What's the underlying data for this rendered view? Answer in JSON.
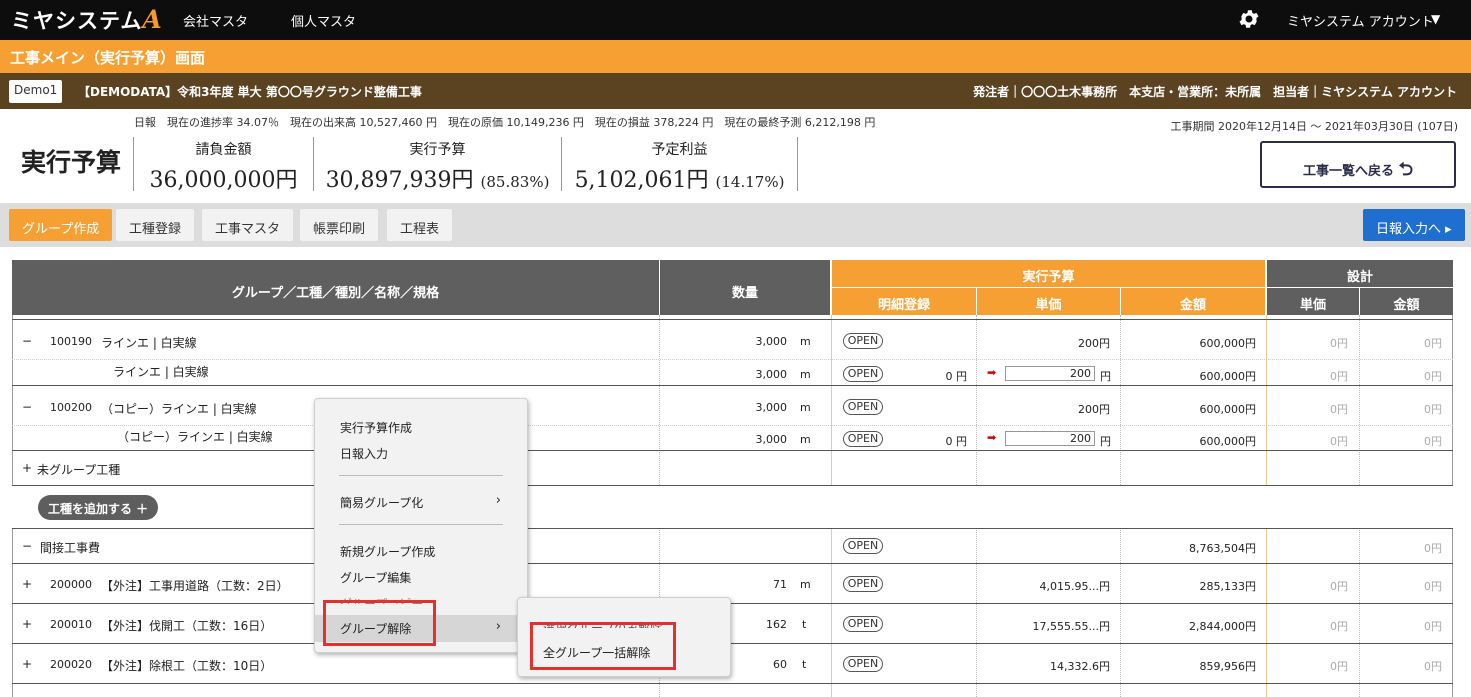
{
  "nav": {
    "logo": "ミヤシステム",
    "logo_accent": "A",
    "links": [
      "会社マスタ",
      "個人マスタ"
    ],
    "account": "ミヤシステム アカウント"
  },
  "screen_title": "工事メイン（実行予算）画面",
  "project": {
    "badge": "Demo1",
    "title": "【DEMODATA】令和3年度 単大 第〇〇号グラウンド整備工事",
    "right": "発注者｜〇〇〇土木事務所　本支店・営業所：未所属　担当者｜ミヤシステム アカウント"
  },
  "stats_line": "日報　現在の進捗率 34.07％　現在の出来高 10,527,460 円　現在の原価 10,149,236 円　現在の損益 378,224 円　現在の最終予測 6,212,198 円",
  "period": "工事期間 2020年12月14日 〜 2021年03月30日 (107日)",
  "summary": {
    "heading": "実行予算",
    "kpis": [
      {
        "label": "請負金額",
        "value": "36,000,000円",
        "pct": ""
      },
      {
        "label": "実行予算",
        "value": "30,897,939円",
        "pct": "(85.83%)"
      },
      {
        "label": "予定利益",
        "value": "5,102,061円",
        "pct": "(14.17%)"
      }
    ],
    "back_button": "工事一覧へ戻る"
  },
  "toolbar": {
    "buttons": [
      "グループ作成",
      "工種登録",
      "工事マスタ",
      "帳票印刷",
      "工程表"
    ],
    "right_button": "日報入力へ"
  },
  "grid": {
    "headers": {
      "name": "グループ／工種／種別／名称／規格",
      "qty": "数量",
      "exec": "実行予算",
      "design": "設計",
      "exec_sub": [
        "明細登録",
        "単価",
        "金額"
      ],
      "design_sub": [
        "単価",
        "金額"
      ]
    },
    "rows": [
      {
        "toggle": "−",
        "code": "100190",
        "name": "ラインエ | 白実線",
        "qty": "3,000",
        "unit": "m",
        "open": "OPEN",
        "detail": "",
        "price": "200円",
        "input": "",
        "amount": "600,000円",
        "d_price": "0円",
        "d_amount": "0円"
      },
      {
        "toggle": "",
        "code": "",
        "name": "ラインエ | 白実線",
        "qty": "3,000",
        "unit": "m",
        "open": "OPEN",
        "detail": "0 円",
        "price": "",
        "input": "200",
        "amount": "600,000円",
        "d_price": "0円",
        "d_amount": "0円"
      },
      {
        "toggle": "−",
        "code": "100200",
        "name": "（コピー）ラインエ | 白実線",
        "qty": "3,000",
        "unit": "m",
        "open": "OPEN",
        "detail": "",
        "price": "200円",
        "input": "",
        "amount": "600,000円",
        "d_price": "0円",
        "d_amount": "0円"
      },
      {
        "toggle": "",
        "code": "",
        "name": "（コピー）ラインエ | 白実線",
        "qty": "3,000",
        "unit": "m",
        "open": "OPEN",
        "detail": "0 円",
        "price": "",
        "input": "200",
        "amount": "600,000円",
        "d_price": "0円",
        "d_amount": "0円"
      },
      {
        "toggle": "+",
        "code": "",
        "name": "未グループ工種",
        "qty": "",
        "unit": "",
        "open": "",
        "detail": "",
        "price": "",
        "input": "",
        "amount": "",
        "d_price": "",
        "d_amount": ""
      },
      {
        "toggle": "−",
        "code": "",
        "name": "間接工事費",
        "qty": "",
        "unit": "",
        "open": "OPEN",
        "detail": "",
        "price": "",
        "input": "",
        "amount": "8,763,504円",
        "d_price": "",
        "d_amount": "0円"
      },
      {
        "toggle": "+",
        "code": "200000",
        "name": "【外注】工事用道路（工数：2日）",
        "qty": "71",
        "unit": "m",
        "open": "OPEN",
        "detail": "",
        "price": "4,015.95...円",
        "input": "",
        "amount": "285,133円",
        "d_price": "0円",
        "d_amount": "0円"
      },
      {
        "toggle": "+",
        "code": "200010",
        "name": "【外注】伐開工（工数：16日）",
        "qty": "162",
        "unit": "t",
        "open": "OPEN",
        "detail": "",
        "price": "17,555.55...円",
        "input": "",
        "amount": "2,844,000円",
        "d_price": "0円",
        "d_amount": "0円"
      },
      {
        "toggle": "+",
        "code": "200020",
        "name": "【外注】除根工（工数：10日）",
        "qty": "60",
        "unit": "t",
        "open": "OPEN",
        "detail": "",
        "price": "14,332.6円",
        "input": "",
        "amount": "859,956円",
        "d_price": "0円",
        "d_amount": "0円"
      }
    ],
    "add_button": "工種を追加する ＋"
  },
  "context_menu": {
    "items": [
      "実行予算作成",
      "日報入力",
      "簡易グループ化",
      "新規グループ作成",
      "グループ編集",
      "グループコピー",
      "グループ解除"
    ],
    "submenu": [
      "選択グループのみ解除",
      "全グループ一括解除"
    ]
  },
  "colors": {
    "accent": "#f6a034",
    "header_grey": "#5f5f5f",
    "brown": "#5b4322",
    "blue": "#1f6fd1",
    "highlight": "#e53030"
  }
}
